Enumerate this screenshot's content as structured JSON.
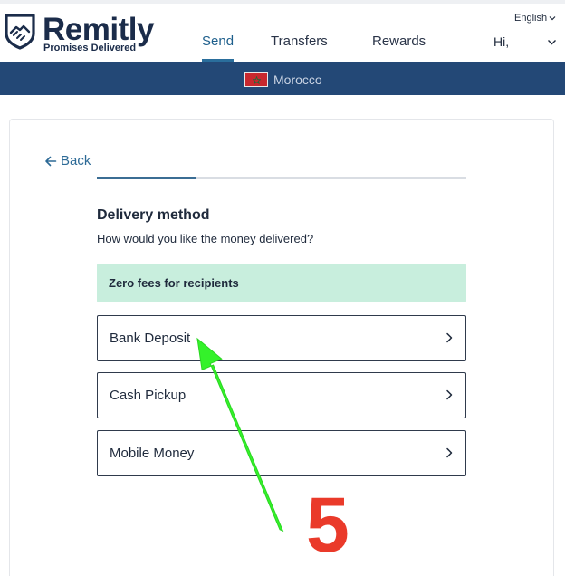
{
  "header": {
    "brand": "Remitly",
    "tagline": "Promises Delivered",
    "nav": [
      {
        "label": "Send",
        "active": true
      },
      {
        "label": "Transfers",
        "active": false
      },
      {
        "label": "Rewards",
        "active": false
      }
    ],
    "language": "English",
    "greeting": "Hi,",
    "icons": {
      "logo": "remitly-shield-logo",
      "language_dropdown": "chevron-down-icon",
      "user_dropdown": "chevron-down-icon"
    }
  },
  "banner": {
    "country": "Morocco",
    "flag_icon": "morocco-flag-icon"
  },
  "form": {
    "back_label": "Back",
    "back_icon": "arrow-left-icon",
    "progress_fraction": 0.27,
    "title": "Delivery method",
    "subtitle": "How would you like the money delivered?",
    "promo": "Zero fees for recipients",
    "options": [
      {
        "label": "Bank Deposit",
        "icon": "chevron-right-icon"
      },
      {
        "label": "Cash Pickup",
        "icon": "chevron-right-icon"
      },
      {
        "label": "Mobile Money",
        "icon": "chevron-right-icon"
      }
    ]
  },
  "annotation": {
    "step_number": "5",
    "arrow_color": "#34f22a",
    "number_color": "#ea3a2a"
  },
  "colors": {
    "brand_navy": "#1b2c4a",
    "banner_blue": "#234876",
    "link_blue": "#2d6a96",
    "promo_green": "#c8eedd"
  }
}
